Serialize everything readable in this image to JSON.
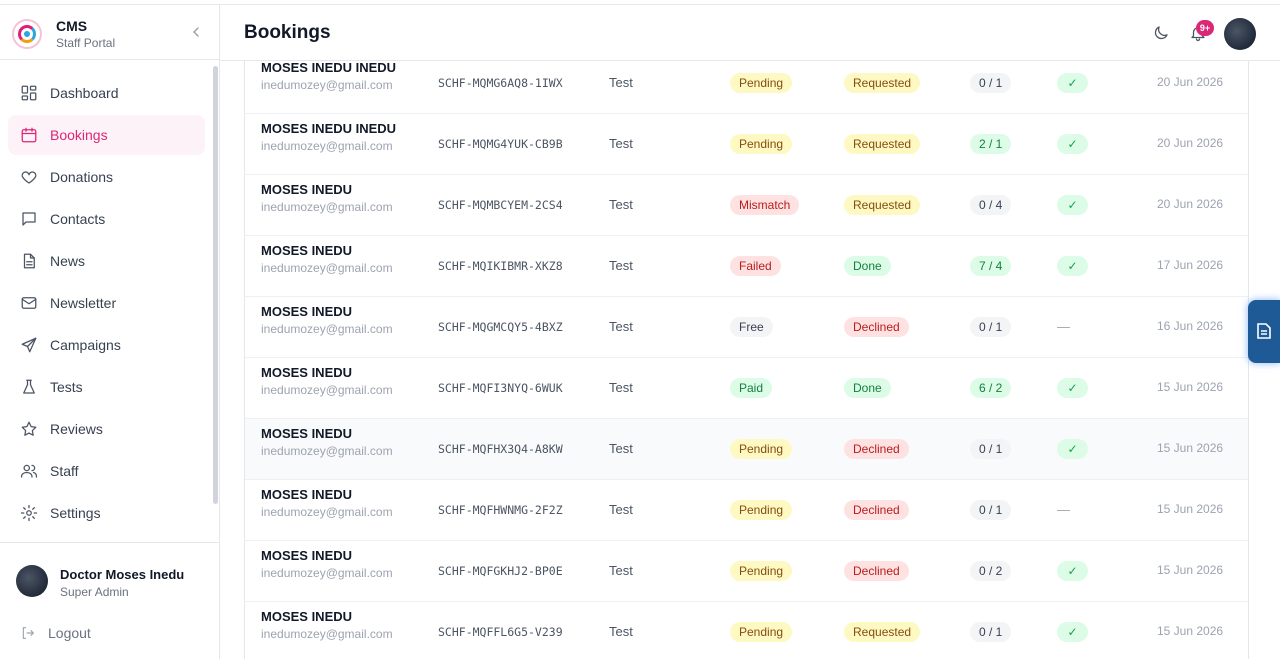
{
  "sidebar": {
    "brand_title": "CMS",
    "brand_sub": "Staff Portal",
    "items": [
      {
        "label": "Dashboard",
        "icon": "dashboard-icon"
      },
      {
        "label": "Bookings",
        "icon": "calendar-icon",
        "active": true
      },
      {
        "label": "Donations",
        "icon": "heart-icon"
      },
      {
        "label": "Contacts",
        "icon": "message-icon"
      },
      {
        "label": "News",
        "icon": "document-icon"
      },
      {
        "label": "Newsletter",
        "icon": "mail-icon"
      },
      {
        "label": "Campaigns",
        "icon": "send-icon"
      },
      {
        "label": "Tests",
        "icon": "flask-icon"
      },
      {
        "label": "Reviews",
        "icon": "star-icon"
      },
      {
        "label": "Staff",
        "icon": "users-icon"
      },
      {
        "label": "Settings",
        "icon": "gear-icon"
      }
    ],
    "user": {
      "name": "Doctor Moses Inedu",
      "role": "Super Admin"
    },
    "logout_label": "Logout"
  },
  "header": {
    "title": "Bookings",
    "notification_count": "9+"
  },
  "colors": {
    "accent": "#db2777",
    "accent_bg": "#fdf2f8"
  },
  "bookings": [
    {
      "name": "MOSES INEDU INEDU",
      "email": "inedumozey@gmail.com",
      "ref": "SCHF-MQMG6AQ8-1IWX",
      "service": "Test",
      "payment": "Pending",
      "payment_tone": "yellow",
      "status": "Requested",
      "status_tone": "yellow",
      "count": "0 / 1",
      "count_tone": "gray",
      "verified": "✓",
      "date": "20 Jun 2026"
    },
    {
      "name": "MOSES INEDU INEDU",
      "email": "inedumozey@gmail.com",
      "ref": "SCHF-MQMG4YUK-CB9B",
      "service": "Test",
      "payment": "Pending",
      "payment_tone": "yellow",
      "status": "Requested",
      "status_tone": "yellow",
      "count": "2 / 1",
      "count_tone": "green",
      "verified": "✓",
      "date": "20 Jun 2026"
    },
    {
      "name": "MOSES INEDU",
      "email": "inedumozey@gmail.com",
      "ref": "SCHF-MQMBCYEM-2CS4",
      "service": "Test",
      "payment": "Mismatch",
      "payment_tone": "red",
      "status": "Requested",
      "status_tone": "yellow",
      "count": "0 / 4",
      "count_tone": "gray",
      "verified": "✓",
      "date": "20 Jun 2026"
    },
    {
      "name": "MOSES INEDU",
      "email": "inedumozey@gmail.com",
      "ref": "SCHF-MQIKIBMR-XKZ8",
      "service": "Test",
      "payment": "Failed",
      "payment_tone": "red",
      "status": "Done",
      "status_tone": "green",
      "count": "7 / 4",
      "count_tone": "green",
      "verified": "✓",
      "date": "17 Jun 2026"
    },
    {
      "name": "MOSES INEDU",
      "email": "inedumozey@gmail.com",
      "ref": "SCHF-MQGMCQY5-4BXZ",
      "service": "Test",
      "payment": "Free",
      "payment_tone": "gray",
      "status": "Declined",
      "status_tone": "red",
      "count": "0 / 1",
      "count_tone": "gray",
      "verified": "—",
      "date": "16 Jun 2026"
    },
    {
      "name": "MOSES INEDU",
      "email": "inedumozey@gmail.com",
      "ref": "SCHF-MQFI3NYQ-6WUK",
      "service": "Test",
      "payment": "Paid",
      "payment_tone": "green",
      "status": "Done",
      "status_tone": "green",
      "count": "6 / 2",
      "count_tone": "green",
      "verified": "✓",
      "date": "15 Jun 2026"
    },
    {
      "name": "MOSES INEDU",
      "email": "inedumozey@gmail.com",
      "ref": "SCHF-MQFHX3Q4-A8KW",
      "service": "Test",
      "payment": "Pending",
      "payment_tone": "yellow",
      "status": "Declined",
      "status_tone": "red",
      "count": "0 / 1",
      "count_tone": "gray",
      "verified": "✓",
      "date": "15 Jun 2026"
    },
    {
      "name": "MOSES INEDU",
      "email": "inedumozey@gmail.com",
      "ref": "SCHF-MQFHWNMG-2F2Z",
      "service": "Test",
      "payment": "Pending",
      "payment_tone": "yellow",
      "status": "Declined",
      "status_tone": "red",
      "count": "0 / 1",
      "count_tone": "gray",
      "verified": "—",
      "date": "15 Jun 2026"
    },
    {
      "name": "MOSES INEDU",
      "email": "inedumozey@gmail.com",
      "ref": "SCHF-MQFGKHJ2-BP0E",
      "service": "Test",
      "payment": "Pending",
      "payment_tone": "yellow",
      "status": "Declined",
      "status_tone": "red",
      "count": "0 / 2",
      "count_tone": "gray",
      "verified": "✓",
      "date": "15 Jun 2026"
    },
    {
      "name": "MOSES INEDU",
      "email": "inedumozey@gmail.com",
      "ref": "SCHF-MQFFL6G5-V239",
      "service": "Test",
      "payment": "Pending",
      "payment_tone": "yellow",
      "status": "Requested",
      "status_tone": "yellow",
      "count": "0 / 1",
      "count_tone": "gray",
      "verified": "✓",
      "date": "15 Jun 2026"
    }
  ]
}
